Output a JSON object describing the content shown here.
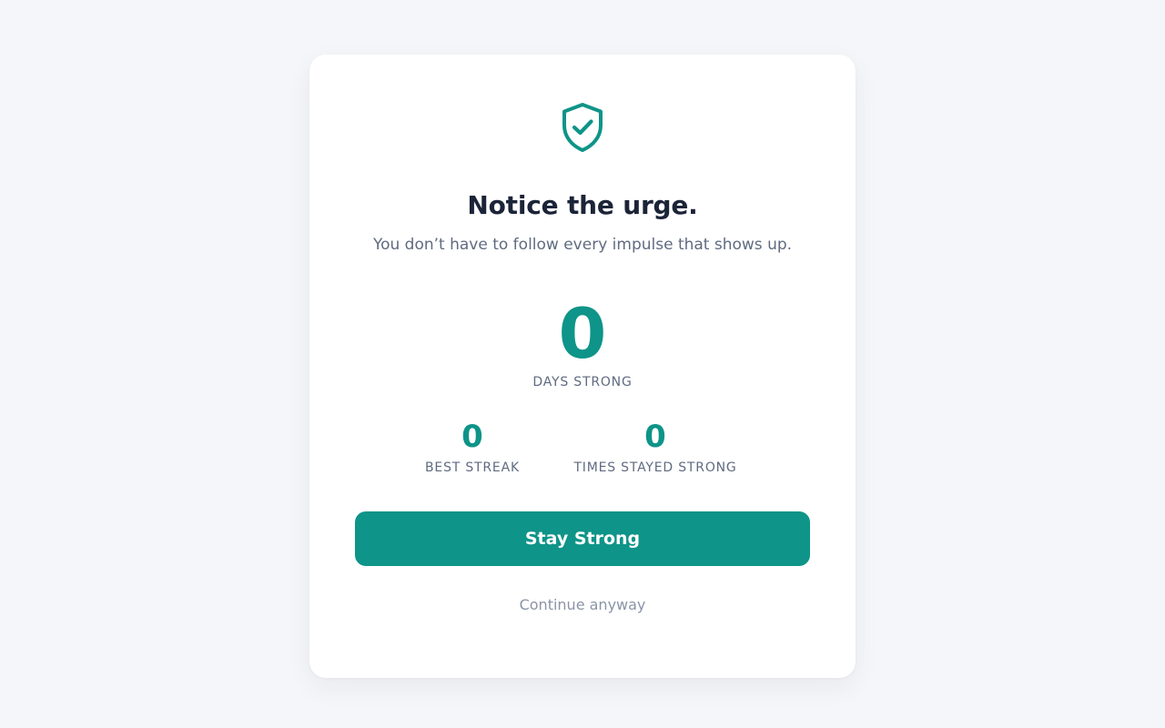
{
  "card": {
    "icon": "shield-check-icon",
    "title": "Notice the urge.",
    "subtitle": "You don’t have to follow every impulse that shows up."
  },
  "streak": {
    "days_value": "0",
    "days_label": "DAYS STRONG"
  },
  "stats": {
    "best_streak_value": "0",
    "best_streak_label": "BEST STREAK",
    "times_stayed_value": "0",
    "times_stayed_label": "TIMES STAYED STRONG"
  },
  "actions": {
    "primary_label": "Stay Strong",
    "secondary_label": "Continue anyway"
  },
  "colors": {
    "accent": "#0e9488",
    "background": "#f5f6f9",
    "card": "#ffffff",
    "title": "#1c2438",
    "muted": "#5f6b80",
    "link": "#8a94a6"
  }
}
